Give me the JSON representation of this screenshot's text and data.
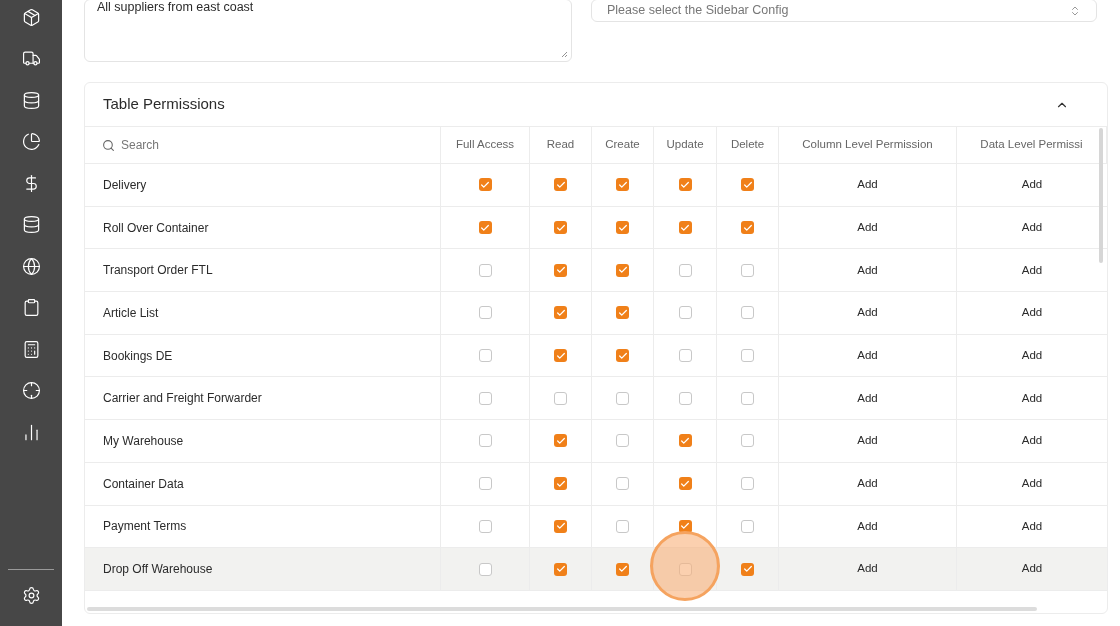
{
  "description": {
    "value": "All suppliers from east coast"
  },
  "sidebar_config": {
    "placeholder": "Please select the Sidebar Config"
  },
  "table_permissions": {
    "title": "Table Permissions",
    "expanded": true,
    "search": {
      "placeholder": "Search"
    },
    "columns": [
      "Full Access",
      "Read",
      "Create",
      "Update",
      "Delete",
      "Column Level Permission",
      "Data Level Permissi"
    ],
    "rows": [
      {
        "name": "Delivery",
        "highlighted": false,
        "full_access": true,
        "read": true,
        "create": true,
        "update": true,
        "delete": true,
        "column_level": "Add",
        "data_level": "Add"
      },
      {
        "name": "Roll Over Container",
        "highlighted": false,
        "full_access": true,
        "read": true,
        "create": true,
        "update": true,
        "delete": true,
        "column_level": "Add",
        "data_level": "Add"
      },
      {
        "name": "Transport Order FTL",
        "highlighted": false,
        "full_access": false,
        "read": true,
        "create": true,
        "update": false,
        "delete": false,
        "column_level": "Add",
        "data_level": "Add"
      },
      {
        "name": "Article List",
        "highlighted": false,
        "full_access": false,
        "read": true,
        "create": true,
        "update": false,
        "delete": false,
        "column_level": "Add",
        "data_level": "Add"
      },
      {
        "name": "Bookings DE",
        "highlighted": false,
        "full_access": false,
        "read": true,
        "create": true,
        "update": false,
        "delete": false,
        "column_level": "Add",
        "data_level": "Add"
      },
      {
        "name": "Carrier and Freight Forwarder",
        "highlighted": false,
        "full_access": false,
        "read": false,
        "create": false,
        "update": false,
        "delete": false,
        "column_level": "Add",
        "data_level": "Add"
      },
      {
        "name": "My Warehouse",
        "highlighted": false,
        "full_access": false,
        "read": true,
        "create": false,
        "update": true,
        "delete": false,
        "column_level": "Add",
        "data_level": "Add"
      },
      {
        "name": "Container Data",
        "highlighted": false,
        "full_access": false,
        "read": true,
        "create": false,
        "update": true,
        "delete": false,
        "column_level": "Add",
        "data_level": "Add"
      },
      {
        "name": "Payment Terms",
        "highlighted": false,
        "full_access": false,
        "read": true,
        "create": false,
        "update": true,
        "delete": false,
        "column_level": "Add",
        "data_level": "Add"
      },
      {
        "name": "Drop Off Warehouse",
        "highlighted": true,
        "full_access": false,
        "read": true,
        "create": true,
        "update": false,
        "delete": true,
        "column_level": "Add",
        "data_level": "Add"
      }
    ]
  }
}
